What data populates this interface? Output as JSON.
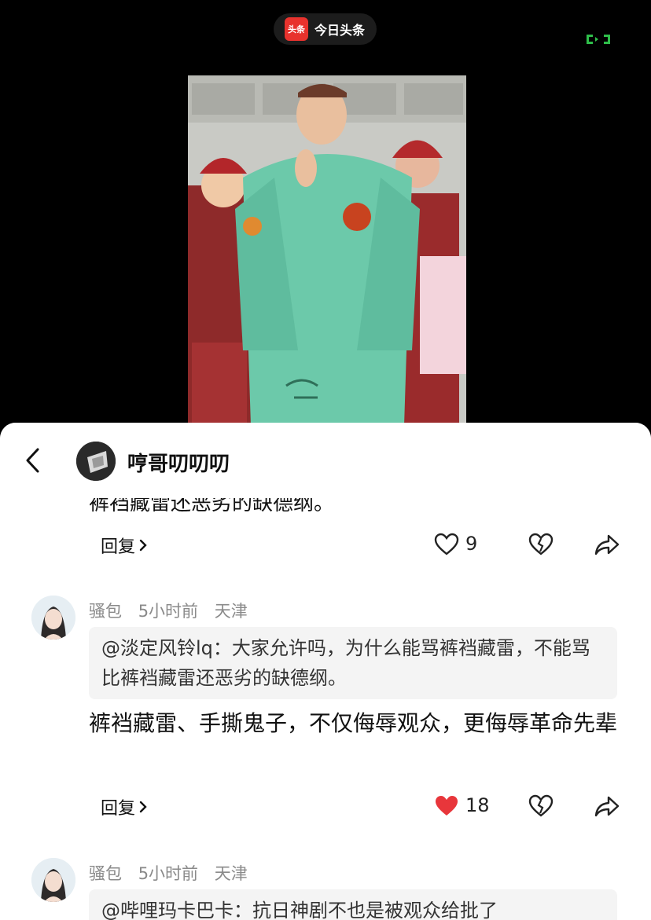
{
  "app": {
    "logo_text": "头条",
    "name": "今日头条"
  },
  "header": {
    "author": "哼哥叨叨叨"
  },
  "prev_comment": {
    "cut_text": "裤裆藏雷还恶劣的缺德纲。",
    "reply_label": "回复",
    "like_count": "9"
  },
  "comments": [
    {
      "user": "骚包",
      "time": "5小时前",
      "location": "天津",
      "quote": "@淡定风铃lq：大家允许吗，为什么能骂裤裆藏雷，不能骂比裤裆藏雷还恶劣的缺德纲。",
      "body": "裤裆藏雷、手撕鬼子，不仅侮辱观众，更侮辱革命先辈",
      "reply_label": "回复",
      "like_count": "18",
      "liked": true
    },
    {
      "user": "骚包",
      "time": "5小时前",
      "location": "天津",
      "quote": "@哔哩玛卡巴卡：抗日神剧不也是被观众给批了"
    }
  ],
  "colors": {
    "liked_red": "#e8363b",
    "brand_red": "#e8322d",
    "gray_text": "#8a8a8a"
  }
}
